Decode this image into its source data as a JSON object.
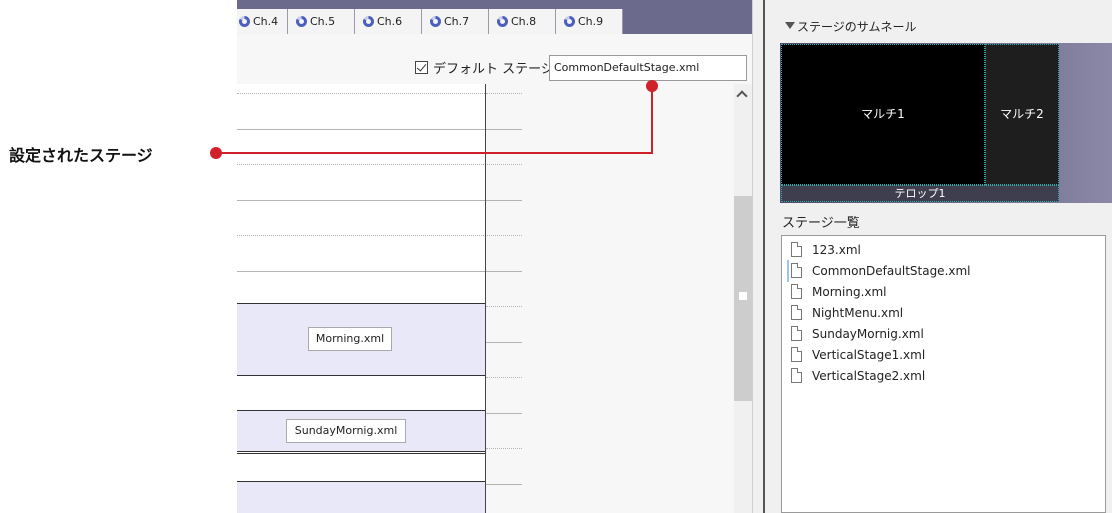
{
  "channel_tabs": [
    "Ch.4",
    "Ch.5",
    "Ch.6",
    "Ch.7",
    "Ch.8",
    "Ch.9"
  ],
  "default_stage": {
    "checkbox_label": "デフォルト ステージ",
    "checked": true,
    "value": "CommonDefaultStage.xml"
  },
  "schedule_blocks": [
    {
      "label": "Morning.xml"
    },
    {
      "label": "SundayMornig.xml"
    },
    {
      "label": ""
    }
  ],
  "thumbnail_panel": {
    "title": "ステージのサムネール",
    "regions": {
      "multi1": "マルチ1",
      "multi2": "マルチ2",
      "telop": "テロップ1"
    }
  },
  "stage_list": {
    "title": "ステージ一覧",
    "items": [
      "123.xml",
      "CommonDefaultStage.xml",
      "Morning.xml",
      "NightMenu.xml",
      "SundayMornig.xml",
      "VerticalStage1.xml",
      "VerticalStage2.xml"
    ],
    "selected": "CommonDefaultStage.xml"
  },
  "callout": {
    "label": "設定されたステージ",
    "color": "#d0202a"
  },
  "colors": {
    "tabstrip": "#6b6a8d",
    "block": "#e8e8f8",
    "selection": "#dbeafb"
  }
}
